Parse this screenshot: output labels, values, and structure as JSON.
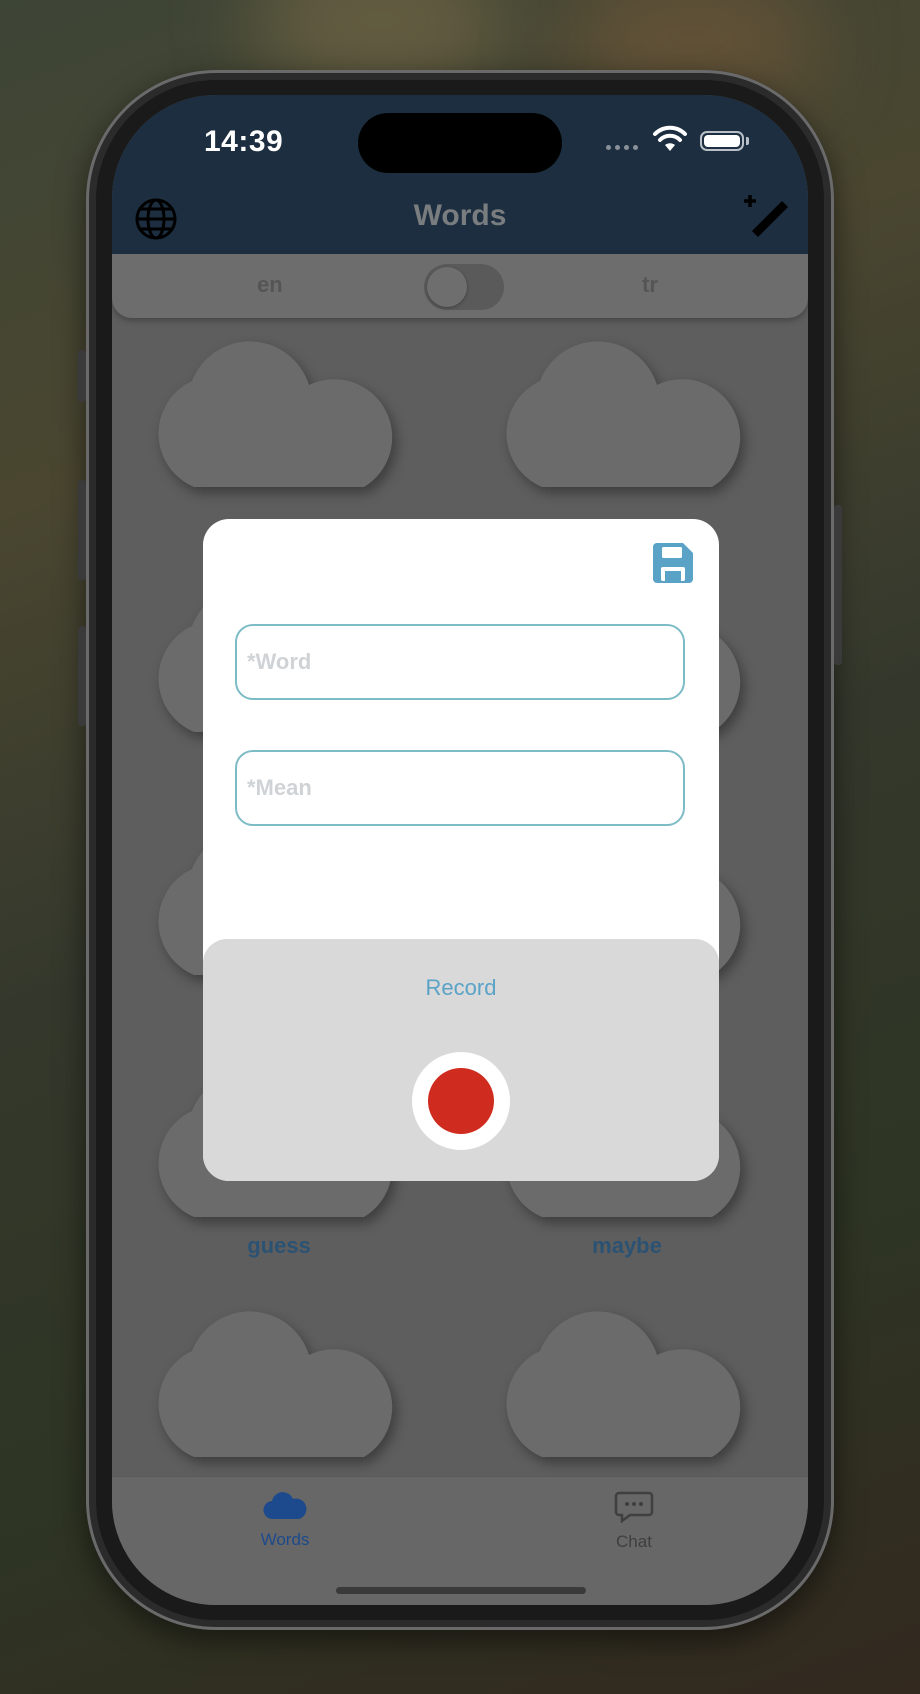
{
  "status_bar": {
    "time": "14:39"
  },
  "header": {
    "title": "Words",
    "left_icon": "globe-icon",
    "right_icon": "magic-wand-icon"
  },
  "language_toggle": {
    "left": "en",
    "right": "tr",
    "state": "off"
  },
  "words": [
    {
      "label": ""
    },
    {
      "label": ""
    },
    {
      "label": ""
    },
    {
      "label": ""
    },
    {
      "label": ""
    },
    {
      "label": ""
    },
    {
      "label": "guess"
    },
    {
      "label": "maybe"
    },
    {
      "label": ""
    },
    {
      "label": ""
    }
  ],
  "modal": {
    "save_icon": "floppy-disk-icon",
    "word_field": {
      "value": "",
      "placeholder": "*Word"
    },
    "mean_field": {
      "value": "",
      "placeholder": "*Mean"
    },
    "record": {
      "title": "Record",
      "button_icon": "record-icon"
    }
  },
  "tabs": [
    {
      "label": "Words",
      "icon": "cloud-icon",
      "active": true
    },
    {
      "label": "Chat",
      "icon": "chat-bubble-icon",
      "active": false
    }
  ],
  "colors": {
    "header_bg": "#1c2e3f",
    "accent_blue": "#5aa3c7",
    "field_border": "#7dbcc6",
    "record_red": "#d02b1f",
    "active_tab": "#1d4a8c",
    "word_label": "#2c5273"
  }
}
